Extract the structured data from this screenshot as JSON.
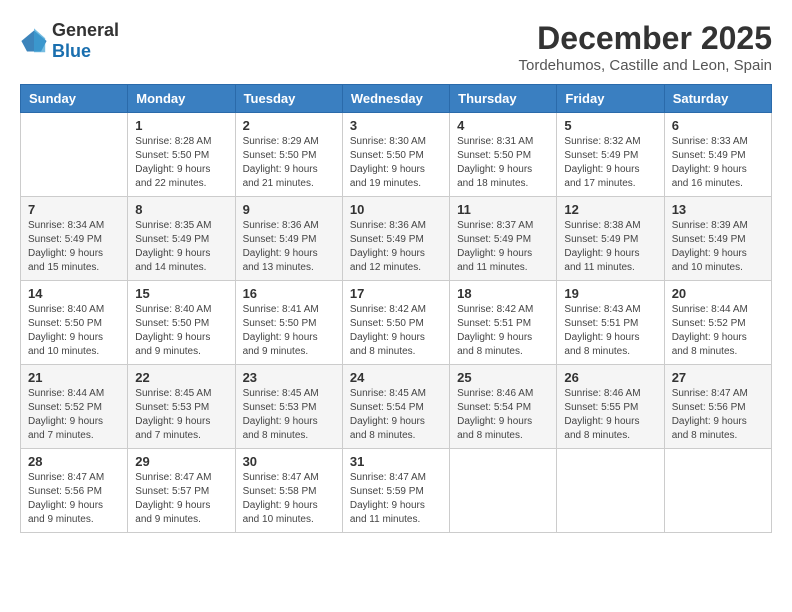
{
  "logo": {
    "general": "General",
    "blue": "Blue"
  },
  "title": "December 2025",
  "location": "Tordehumos, Castille and Leon, Spain",
  "days_of_week": [
    "Sunday",
    "Monday",
    "Tuesday",
    "Wednesday",
    "Thursday",
    "Friday",
    "Saturday"
  ],
  "weeks": [
    [
      {
        "day": "",
        "sunrise": "",
        "sunset": "",
        "daylight": ""
      },
      {
        "day": "1",
        "sunrise": "Sunrise: 8:28 AM",
        "sunset": "Sunset: 5:50 PM",
        "daylight": "Daylight: 9 hours and 22 minutes."
      },
      {
        "day": "2",
        "sunrise": "Sunrise: 8:29 AM",
        "sunset": "Sunset: 5:50 PM",
        "daylight": "Daylight: 9 hours and 21 minutes."
      },
      {
        "day": "3",
        "sunrise": "Sunrise: 8:30 AM",
        "sunset": "Sunset: 5:50 PM",
        "daylight": "Daylight: 9 hours and 19 minutes."
      },
      {
        "day": "4",
        "sunrise": "Sunrise: 8:31 AM",
        "sunset": "Sunset: 5:50 PM",
        "daylight": "Daylight: 9 hours and 18 minutes."
      },
      {
        "day": "5",
        "sunrise": "Sunrise: 8:32 AM",
        "sunset": "Sunset: 5:49 PM",
        "daylight": "Daylight: 9 hours and 17 minutes."
      },
      {
        "day": "6",
        "sunrise": "Sunrise: 8:33 AM",
        "sunset": "Sunset: 5:49 PM",
        "daylight": "Daylight: 9 hours and 16 minutes."
      }
    ],
    [
      {
        "day": "7",
        "sunrise": "Sunrise: 8:34 AM",
        "sunset": "Sunset: 5:49 PM",
        "daylight": "Daylight: 9 hours and 15 minutes."
      },
      {
        "day": "8",
        "sunrise": "Sunrise: 8:35 AM",
        "sunset": "Sunset: 5:49 PM",
        "daylight": "Daylight: 9 hours and 14 minutes."
      },
      {
        "day": "9",
        "sunrise": "Sunrise: 8:36 AM",
        "sunset": "Sunset: 5:49 PM",
        "daylight": "Daylight: 9 hours and 13 minutes."
      },
      {
        "day": "10",
        "sunrise": "Sunrise: 8:36 AM",
        "sunset": "Sunset: 5:49 PM",
        "daylight": "Daylight: 9 hours and 12 minutes."
      },
      {
        "day": "11",
        "sunrise": "Sunrise: 8:37 AM",
        "sunset": "Sunset: 5:49 PM",
        "daylight": "Daylight: 9 hours and 11 minutes."
      },
      {
        "day": "12",
        "sunrise": "Sunrise: 8:38 AM",
        "sunset": "Sunset: 5:49 PM",
        "daylight": "Daylight: 9 hours and 11 minutes."
      },
      {
        "day": "13",
        "sunrise": "Sunrise: 8:39 AM",
        "sunset": "Sunset: 5:49 PM",
        "daylight": "Daylight: 9 hours and 10 minutes."
      }
    ],
    [
      {
        "day": "14",
        "sunrise": "Sunrise: 8:40 AM",
        "sunset": "Sunset: 5:50 PM",
        "daylight": "Daylight: 9 hours and 10 minutes."
      },
      {
        "day": "15",
        "sunrise": "Sunrise: 8:40 AM",
        "sunset": "Sunset: 5:50 PM",
        "daylight": "Daylight: 9 hours and 9 minutes."
      },
      {
        "day": "16",
        "sunrise": "Sunrise: 8:41 AM",
        "sunset": "Sunset: 5:50 PM",
        "daylight": "Daylight: 9 hours and 9 minutes."
      },
      {
        "day": "17",
        "sunrise": "Sunrise: 8:42 AM",
        "sunset": "Sunset: 5:50 PM",
        "daylight": "Daylight: 9 hours and 8 minutes."
      },
      {
        "day": "18",
        "sunrise": "Sunrise: 8:42 AM",
        "sunset": "Sunset: 5:51 PM",
        "daylight": "Daylight: 9 hours and 8 minutes."
      },
      {
        "day": "19",
        "sunrise": "Sunrise: 8:43 AM",
        "sunset": "Sunset: 5:51 PM",
        "daylight": "Daylight: 9 hours and 8 minutes."
      },
      {
        "day": "20",
        "sunrise": "Sunrise: 8:44 AM",
        "sunset": "Sunset: 5:52 PM",
        "daylight": "Daylight: 9 hours and 8 minutes."
      }
    ],
    [
      {
        "day": "21",
        "sunrise": "Sunrise: 8:44 AM",
        "sunset": "Sunset: 5:52 PM",
        "daylight": "Daylight: 9 hours and 7 minutes."
      },
      {
        "day": "22",
        "sunrise": "Sunrise: 8:45 AM",
        "sunset": "Sunset: 5:53 PM",
        "daylight": "Daylight: 9 hours and 7 minutes."
      },
      {
        "day": "23",
        "sunrise": "Sunrise: 8:45 AM",
        "sunset": "Sunset: 5:53 PM",
        "daylight": "Daylight: 9 hours and 8 minutes."
      },
      {
        "day": "24",
        "sunrise": "Sunrise: 8:45 AM",
        "sunset": "Sunset: 5:54 PM",
        "daylight": "Daylight: 9 hours and 8 minutes."
      },
      {
        "day": "25",
        "sunrise": "Sunrise: 8:46 AM",
        "sunset": "Sunset: 5:54 PM",
        "daylight": "Daylight: 9 hours and 8 minutes."
      },
      {
        "day": "26",
        "sunrise": "Sunrise: 8:46 AM",
        "sunset": "Sunset: 5:55 PM",
        "daylight": "Daylight: 9 hours and 8 minutes."
      },
      {
        "day": "27",
        "sunrise": "Sunrise: 8:47 AM",
        "sunset": "Sunset: 5:56 PM",
        "daylight": "Daylight: 9 hours and 8 minutes."
      }
    ],
    [
      {
        "day": "28",
        "sunrise": "Sunrise: 8:47 AM",
        "sunset": "Sunset: 5:56 PM",
        "daylight": "Daylight: 9 hours and 9 minutes."
      },
      {
        "day": "29",
        "sunrise": "Sunrise: 8:47 AM",
        "sunset": "Sunset: 5:57 PM",
        "daylight": "Daylight: 9 hours and 9 minutes."
      },
      {
        "day": "30",
        "sunrise": "Sunrise: 8:47 AM",
        "sunset": "Sunset: 5:58 PM",
        "daylight": "Daylight: 9 hours and 10 minutes."
      },
      {
        "day": "31",
        "sunrise": "Sunrise: 8:47 AM",
        "sunset": "Sunset: 5:59 PM",
        "daylight": "Daylight: 9 hours and 11 minutes."
      },
      {
        "day": "",
        "sunrise": "",
        "sunset": "",
        "daylight": ""
      },
      {
        "day": "",
        "sunrise": "",
        "sunset": "",
        "daylight": ""
      },
      {
        "day": "",
        "sunrise": "",
        "sunset": "",
        "daylight": ""
      }
    ]
  ]
}
